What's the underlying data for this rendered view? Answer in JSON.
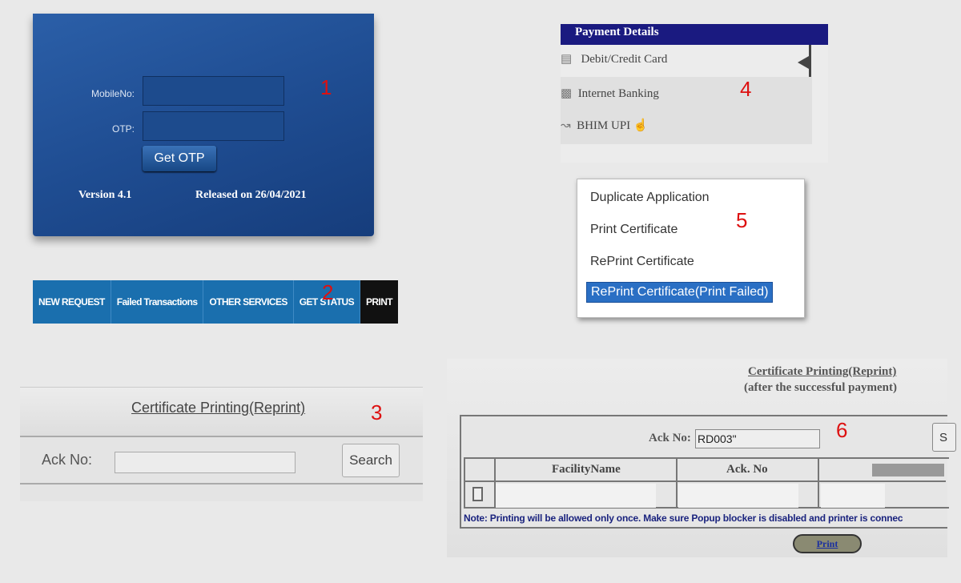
{
  "panel1": {
    "mobile_label": "MobileNo:",
    "mobile_value": "",
    "otp_label": "OTP:",
    "otp_value": "",
    "get_otp": "Get OTP",
    "version": "Version 4.1",
    "released": "Released on 26/04/2021",
    "step": "1"
  },
  "panel2": {
    "tabs": [
      "NEW REQUEST",
      "Failed Transactions",
      "OTHER SERVICES",
      "GET STATUS",
      "PRINT"
    ],
    "step": "2"
  },
  "panel3": {
    "title": "Certificate Printing(Reprint)",
    "ack_label": "Ack No:",
    "ack_value": "",
    "search": "Search",
    "step": "3"
  },
  "panel4": {
    "header": "Payment Details",
    "items": [
      "Debit/Credit Card",
      "Internet Banking",
      "BHIM UPI"
    ],
    "step": "4"
  },
  "panel5": {
    "items": [
      "Duplicate Application",
      "Print Certificate",
      "RePrint Certificate",
      "RePrint Certificate(Print Failed)"
    ],
    "step": "5"
  },
  "panel6": {
    "title": "Certificate Printing(Reprint)",
    "subtitle": "(after the successful payment)",
    "ack_label": "Ack No:",
    "ack_value": "RD003\"",
    "search_partial": "S",
    "columns": [
      "FacilityName",
      "Ack. No"
    ],
    "note": "Note: Printing will be allowed only once. Make sure Popup blocker is disabled and printer is connec",
    "print": "Print",
    "step": "6"
  },
  "colors": {
    "accent_blue": "#1a6fae",
    "payment_header": "#1a1a80",
    "step_number": "#dd1111"
  }
}
